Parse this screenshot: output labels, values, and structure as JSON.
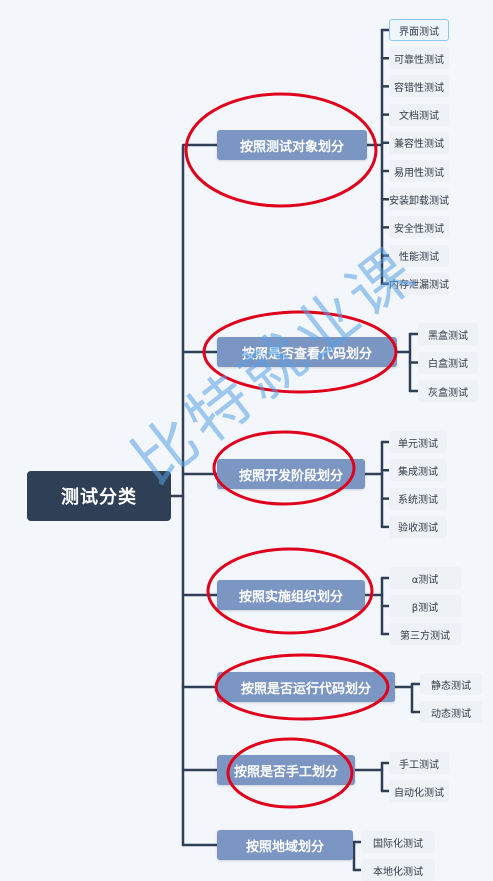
{
  "root": {
    "label": "测试分类"
  },
  "categories": [
    {
      "id": "c0",
      "label": "按照测试对象划分",
      "children": [
        "界面测试",
        "可靠性测试",
        "容错性测试",
        "文档测试",
        "兼容性测试",
        "易用性测试",
        "安装卸载测试",
        "安全性测试",
        "性能测试",
        "内存泄漏测试"
      ]
    },
    {
      "id": "c1",
      "label": "按照是否查看代码划分",
      "children": [
        "黑盒测试",
        "白盒测试",
        "灰盒测试"
      ]
    },
    {
      "id": "c2",
      "label": "按照开发阶段划分",
      "children": [
        "单元测试",
        "集成测试",
        "系统测试",
        "验收测试"
      ]
    },
    {
      "id": "c3",
      "label": "按照实施组织划分",
      "children": [
        "α测试",
        "β测试",
        "第三方测试"
      ]
    },
    {
      "id": "c4",
      "label": "按照是否运行代码划分",
      "children": [
        "静态测试",
        "动态测试"
      ]
    },
    {
      "id": "c5",
      "label": "按照是否手工划分",
      "children": [
        "手工测试",
        "自动化测试"
      ]
    },
    {
      "id": "c6",
      "label": "按照地域划分",
      "children": [
        "国际化测试",
        "本地化测试"
      ]
    }
  ],
  "watermark": {
    "text": "比特就业课"
  },
  "colors": {
    "root_bg": "#2f3f56",
    "category_bg": "#7b96c3",
    "leaf_bg": "#eef1f5",
    "line": "#2f3f56",
    "circle": "#e0001b",
    "watermark": "#56a0e6"
  }
}
